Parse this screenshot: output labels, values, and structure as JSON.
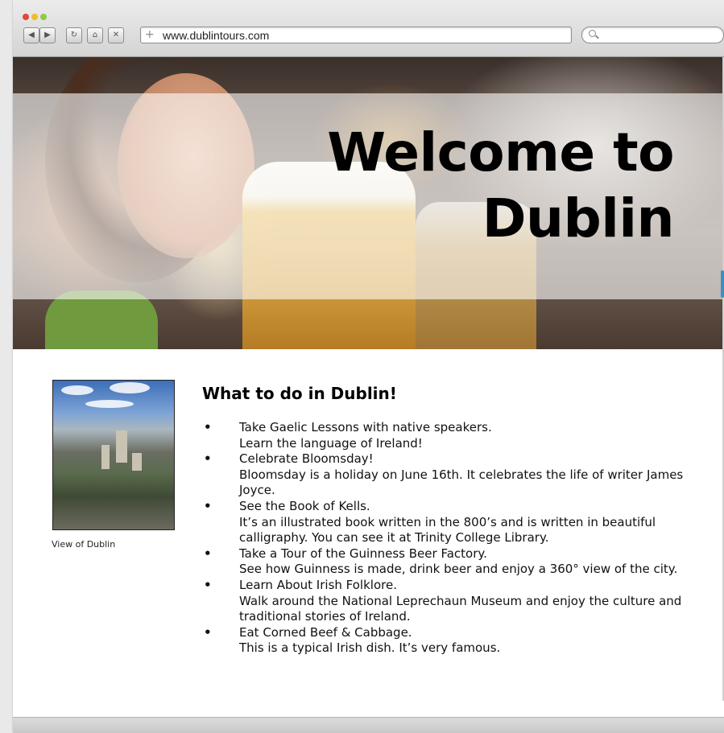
{
  "browser": {
    "url": "www.dublintours.com",
    "nav_icons": [
      "back-icon",
      "forward-icon",
      "reload-icon",
      "home-icon",
      "stop-icon"
    ],
    "add_icon": "plus-icon",
    "search_icon": "magnifier-icon"
  },
  "hero": {
    "title_line1": "Welcome to",
    "title_line2": "Dublin"
  },
  "sidebar": {
    "caption": "View of Dublin"
  },
  "main": {
    "heading": "What to do in Dublin!",
    "items": [
      {
        "title": "Take Gaelic Lessons with native speakers.",
        "desc": "Learn the language of Ireland!"
      },
      {
        "title": "Celebrate Bloomsday!",
        "desc": "Bloomsday is a holiday on June 16th. It celebrates the life of writer James Joyce."
      },
      {
        "title": "See the Book of Kells.",
        "desc": "It’s an illustrated book written in the 800’s and is written in beautiful calligraphy. You can see it at Trinity College Library."
      },
      {
        "title": "Take a Tour of the Guinness Beer Factory.",
        "desc": "See how Guinness is made, drink beer and enjoy a 360° view of the city."
      },
      {
        "title": "Learn About Irish Folklore.",
        "desc": "Walk around the National Leprechaun Museum and enjoy the culture and traditional stories of Ireland."
      },
      {
        "title": "Eat Corned Beef & Cabbage.",
        "desc": "This is a typical Irish dish. It’s very famous."
      }
    ]
  },
  "colors": {
    "toolbar": "#d8d8d8",
    "scrollbar_accent": "#3a8fc6"
  }
}
